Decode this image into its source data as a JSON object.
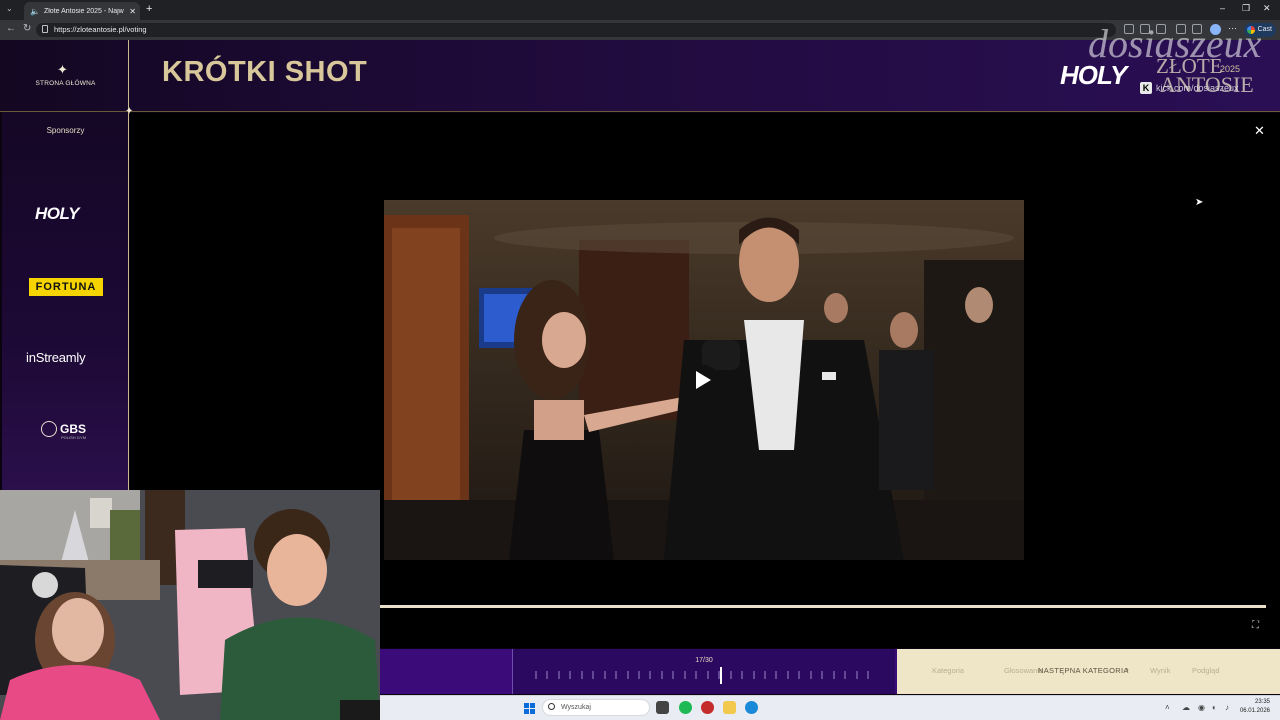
{
  "browser": {
    "tab_title": "Złote Antosie 2025 - Najwięk",
    "url": "https://zloteantosie.pl/voting",
    "cast_label": "Cast"
  },
  "site": {
    "home_label": "STRONA GŁÓWNA",
    "page_title": "KRÓTKI SHOT",
    "brand": {
      "holy": "HOLY",
      "zlote": "ZŁOTE",
      "year": "2025",
      "antosie": "ANTOSIE"
    },
    "overlay": {
      "watermark": "dosiaszeux",
      "kick_handle": "kick.com/dosiaszeux"
    },
    "sponsors_label": "Sponsorzy",
    "sponsors": {
      "holy": "HOLY",
      "fortuna": "FORTUNA",
      "instreamly": "inStreamly",
      "gbs": "GBS",
      "gbs_sub": "POLISH GYM"
    }
  },
  "player": {
    "counter": "17/30",
    "current": 17,
    "total": 30,
    "progress": 1.0,
    "next_label": "NASTĘPNA KATEGORIA",
    "ghost_labels": [
      "Kategoria",
      "Głosowanie",
      "Wynik",
      "Podgląd"
    ]
  },
  "taskbar": {
    "search_placeholder": "Wyszukaj",
    "time": "23:35",
    "date": "06.01.2026"
  },
  "colors": {
    "gold": "#d8c79a",
    "purple": "#3c0b7a",
    "fortuna_yellow": "#f6d400"
  }
}
